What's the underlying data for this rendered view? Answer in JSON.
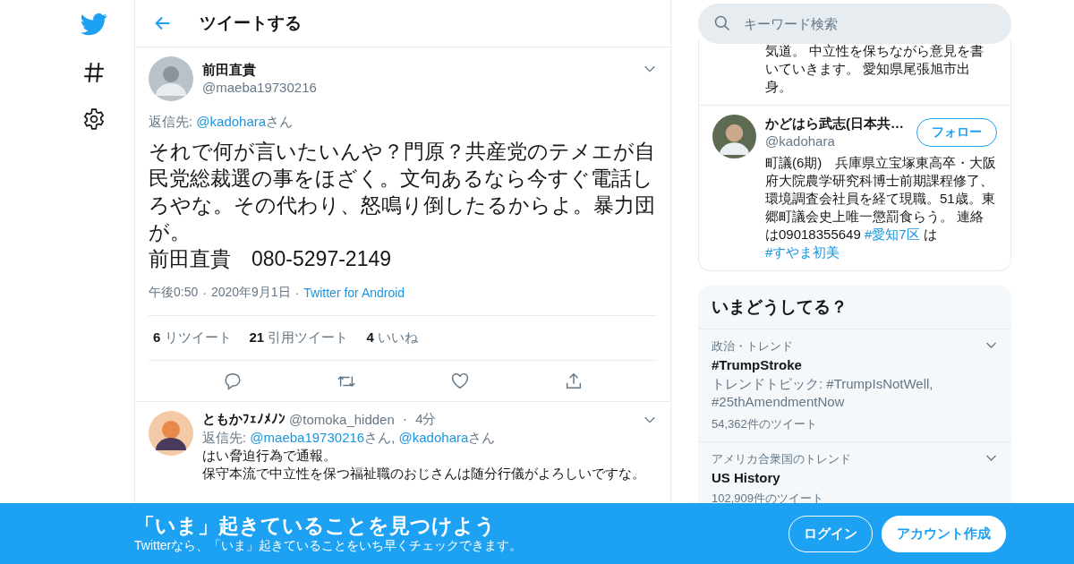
{
  "header": {
    "title": "ツイートする"
  },
  "tweet": {
    "author": {
      "name": "前田直貴",
      "handle": "@maeba19730216"
    },
    "reply_to": [
      {
        "kind": "text",
        "text": "返信先: "
      },
      {
        "kind": "link",
        "text": "@kadohara"
      },
      {
        "kind": "text",
        "text": "さん"
      }
    ],
    "text_lines": [
      "それで何が言いたいんや？門原？共産党のテメエが自民党総裁選の事をほざく。文句あるなら今すぐ電話しろやな。その代わり、怒鳴り倒したるからよ。暴力団が。",
      "前田直貴　080-5297-2149"
    ],
    "separator": "·",
    "time": "午後0:50",
    "date": "2020年9月1日",
    "source": "Twitter for Android",
    "stats": [
      {
        "count": "6",
        "label": "リツイート"
      },
      {
        "count": "21",
        "label": "引用ツイート"
      },
      {
        "count": "4",
        "label": "いいね"
      }
    ],
    "actions": [
      {
        "kind": "reply"
      },
      {
        "kind": "retweet"
      },
      {
        "kind": "like"
      },
      {
        "kind": "share"
      }
    ]
  },
  "reply": {
    "name": "ともかﾌｪﾉﾒﾉﾝ",
    "handle": "@tomoka_hidden",
    "separator": "·",
    "age": "4分",
    "reply_to": [
      {
        "kind": "text",
        "text": "返信先: "
      },
      {
        "kind": "link",
        "text": "@maeba19730216"
      },
      {
        "kind": "text",
        "text": "さん, "
      },
      {
        "kind": "link",
        "text": "@kadohara"
      },
      {
        "kind": "text",
        "text": "さん"
      }
    ],
    "text_lines": [
      "はい脅迫行為で通報。",
      "保守本流で中立性を保つ福祉職のおじさんは随分行儀がよろしいですな。"
    ]
  },
  "search": {
    "placeholder": "キーワード検索"
  },
  "users": [
    {
      "kind": "continued",
      "bio": [
        {
          "kind": "text",
          "text": "気道。 中立性を保ちながら意見を書いていきます。 愛知県尾張旭市出身。"
        }
      ]
    },
    {
      "kind": "full",
      "name": "かどはら武志(日本共…",
      "handle": "@kadohara",
      "button": "フォロー",
      "bio": [
        {
          "kind": "text",
          "text": "町議(6期)　兵庫県立宝塚東高卒・大阪府大院農学研究科博士前期課程修了、環境調査会社員を経て現職。51歳。東郷町議会史上唯一懲罰食らう。 連絡は09018355649 "
        },
        {
          "kind": "link",
          "text": "#愛知7区"
        },
        {
          "kind": "text",
          "text": " は "
        },
        {
          "kind": "link",
          "text": "#すやま初美"
        }
      ]
    }
  ],
  "trends": {
    "title": "いまどうしてる？",
    "items": [
      {
        "context": "政治・トレンド",
        "name": "#TrumpStroke",
        "description": "トレンドトピック: #TrumpIsNotWell, #25thAmendmentNow",
        "count": "54,362件のツイート"
      },
      {
        "context": "アメリカ合衆国のトレンド",
        "name": "US History",
        "count": "102,909件のツイート"
      }
    ]
  },
  "banner": {
    "title": "「いま」起きていることを見つけよう",
    "subtitle": "Twitterなら、「いま」起きていることをいち早くチェックできます。",
    "buttons": [
      {
        "kind": "outline",
        "label": "ログイン"
      },
      {
        "kind": "solid",
        "label": "アカウント作成"
      }
    ]
  }
}
